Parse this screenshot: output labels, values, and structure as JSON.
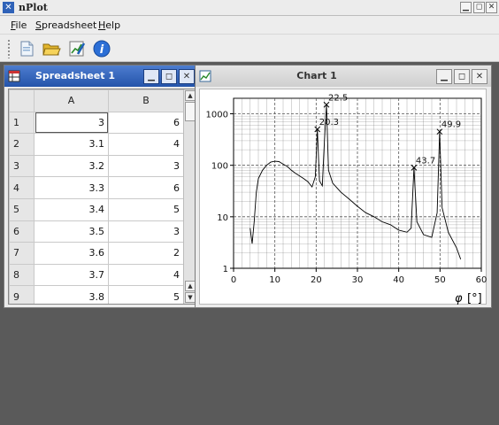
{
  "app": {
    "title": "nPlot",
    "icon": "x-app-icon"
  },
  "window_controls": [
    "minimize",
    "maximize",
    "close"
  ],
  "menu": [
    "File",
    "Spreadsheet",
    "Help"
  ],
  "toolbar": [
    "new-document-icon",
    "open-folder-icon",
    "chart-edit-icon",
    "info-icon"
  ],
  "spreadsheet": {
    "title": "Spreadsheet 1",
    "columns": [
      "A",
      "B"
    ],
    "rows": [
      {
        "n": "1",
        "a": "3",
        "b": "6"
      },
      {
        "n": "2",
        "a": "3.1",
        "b": "4"
      },
      {
        "n": "3",
        "a": "3.2",
        "b": "3"
      },
      {
        "n": "4",
        "a": "3.3",
        "b": "6"
      },
      {
        "n": "5",
        "a": "3.4",
        "b": "5"
      },
      {
        "n": "6",
        "a": "3.5",
        "b": "3"
      },
      {
        "n": "7",
        "a": "3.6",
        "b": "2"
      },
      {
        "n": "8",
        "a": "3.7",
        "b": "4"
      },
      {
        "n": "9",
        "a": "3.8",
        "b": "5"
      }
    ]
  },
  "chart": {
    "title": "Chart 1",
    "xlabel_symbol": "φ",
    "xlabel_unit": "[°]"
  },
  "chart_data": {
    "type": "line",
    "yscale": "log",
    "xlim": [
      0,
      60
    ],
    "ylim": [
      1,
      2000
    ],
    "xticks": [
      "0",
      "10",
      "20",
      "30",
      "40",
      "50",
      "60"
    ],
    "yticks": [
      "1",
      "10",
      "100",
      "1000"
    ],
    "grid": true,
    "x": [
      4,
      4.5,
      5,
      5.5,
      6,
      7,
      8,
      9,
      10,
      11,
      12,
      13,
      14,
      15,
      16,
      17,
      18,
      19,
      19.8,
      20.3,
      20.8,
      21.5,
      22,
      22.5,
      23,
      24,
      26,
      28,
      30,
      32,
      34,
      36,
      38,
      40,
      42,
      43,
      43.7,
      44.4,
      46,
      48,
      49.3,
      49.9,
      50.5,
      52,
      54,
      55
    ],
    "y": [
      6,
      3,
      8,
      30,
      55,
      80,
      100,
      115,
      120,
      118,
      105,
      95,
      80,
      70,
      62,
      55,
      48,
      38,
      60,
      500,
      50,
      40,
      300,
      1500,
      80,
      45,
      30,
      22,
      16,
      12,
      10,
      8,
      7,
      5.5,
      5,
      6,
      90,
      8,
      4.5,
      4,
      12,
      450,
      15,
      5,
      2.5,
      1.5
    ],
    "annotations": [
      {
        "x": 20.3,
        "y": 500,
        "label": "20.3"
      },
      {
        "x": 22.5,
        "y": 1500,
        "label": "22.5"
      },
      {
        "x": 43.7,
        "y": 90,
        "label": "43.7"
      },
      {
        "x": 49.9,
        "y": 450,
        "label": "49.9"
      }
    ],
    "colors": {
      "line": "#000000",
      "grid": "#555555"
    }
  }
}
